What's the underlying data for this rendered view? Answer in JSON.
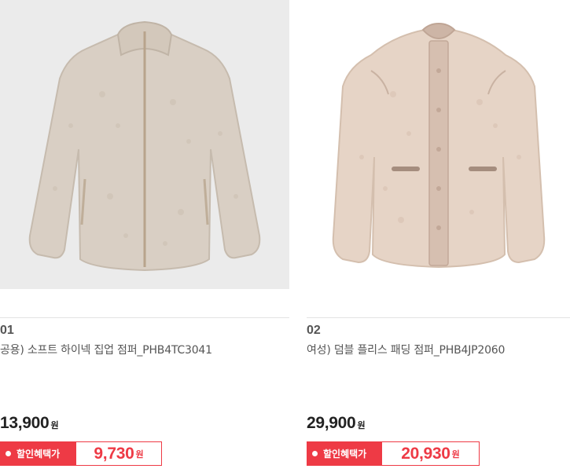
{
  "products": [
    {
      "rank": "01",
      "name": "공용) 소프트 하이넥 집업 점퍼_PHB4TC3041",
      "price": "13,900",
      "price_unit": "원",
      "sale_label": "할인혜택가",
      "sale_price": "9,730",
      "sale_unit": "원",
      "image_icon": "fleece-zip-jacket-image",
      "image_bg": "#ebebeb",
      "garment_color": "#d9cfc4"
    },
    {
      "rank": "02",
      "name": "여성) 덤블 플리스 패딩 점퍼_PHB4JP2060",
      "price": "29,900",
      "price_unit": "원",
      "sale_label": "할인혜택가",
      "sale_price": "20,930",
      "sale_unit": "원",
      "image_icon": "fleece-padding-jacket-image",
      "image_bg": "#ffffff",
      "garment_color": "#e6d4c6"
    }
  ],
  "colors": {
    "sale_red": "#ee3a45",
    "divider": "#e3e3e3"
  }
}
